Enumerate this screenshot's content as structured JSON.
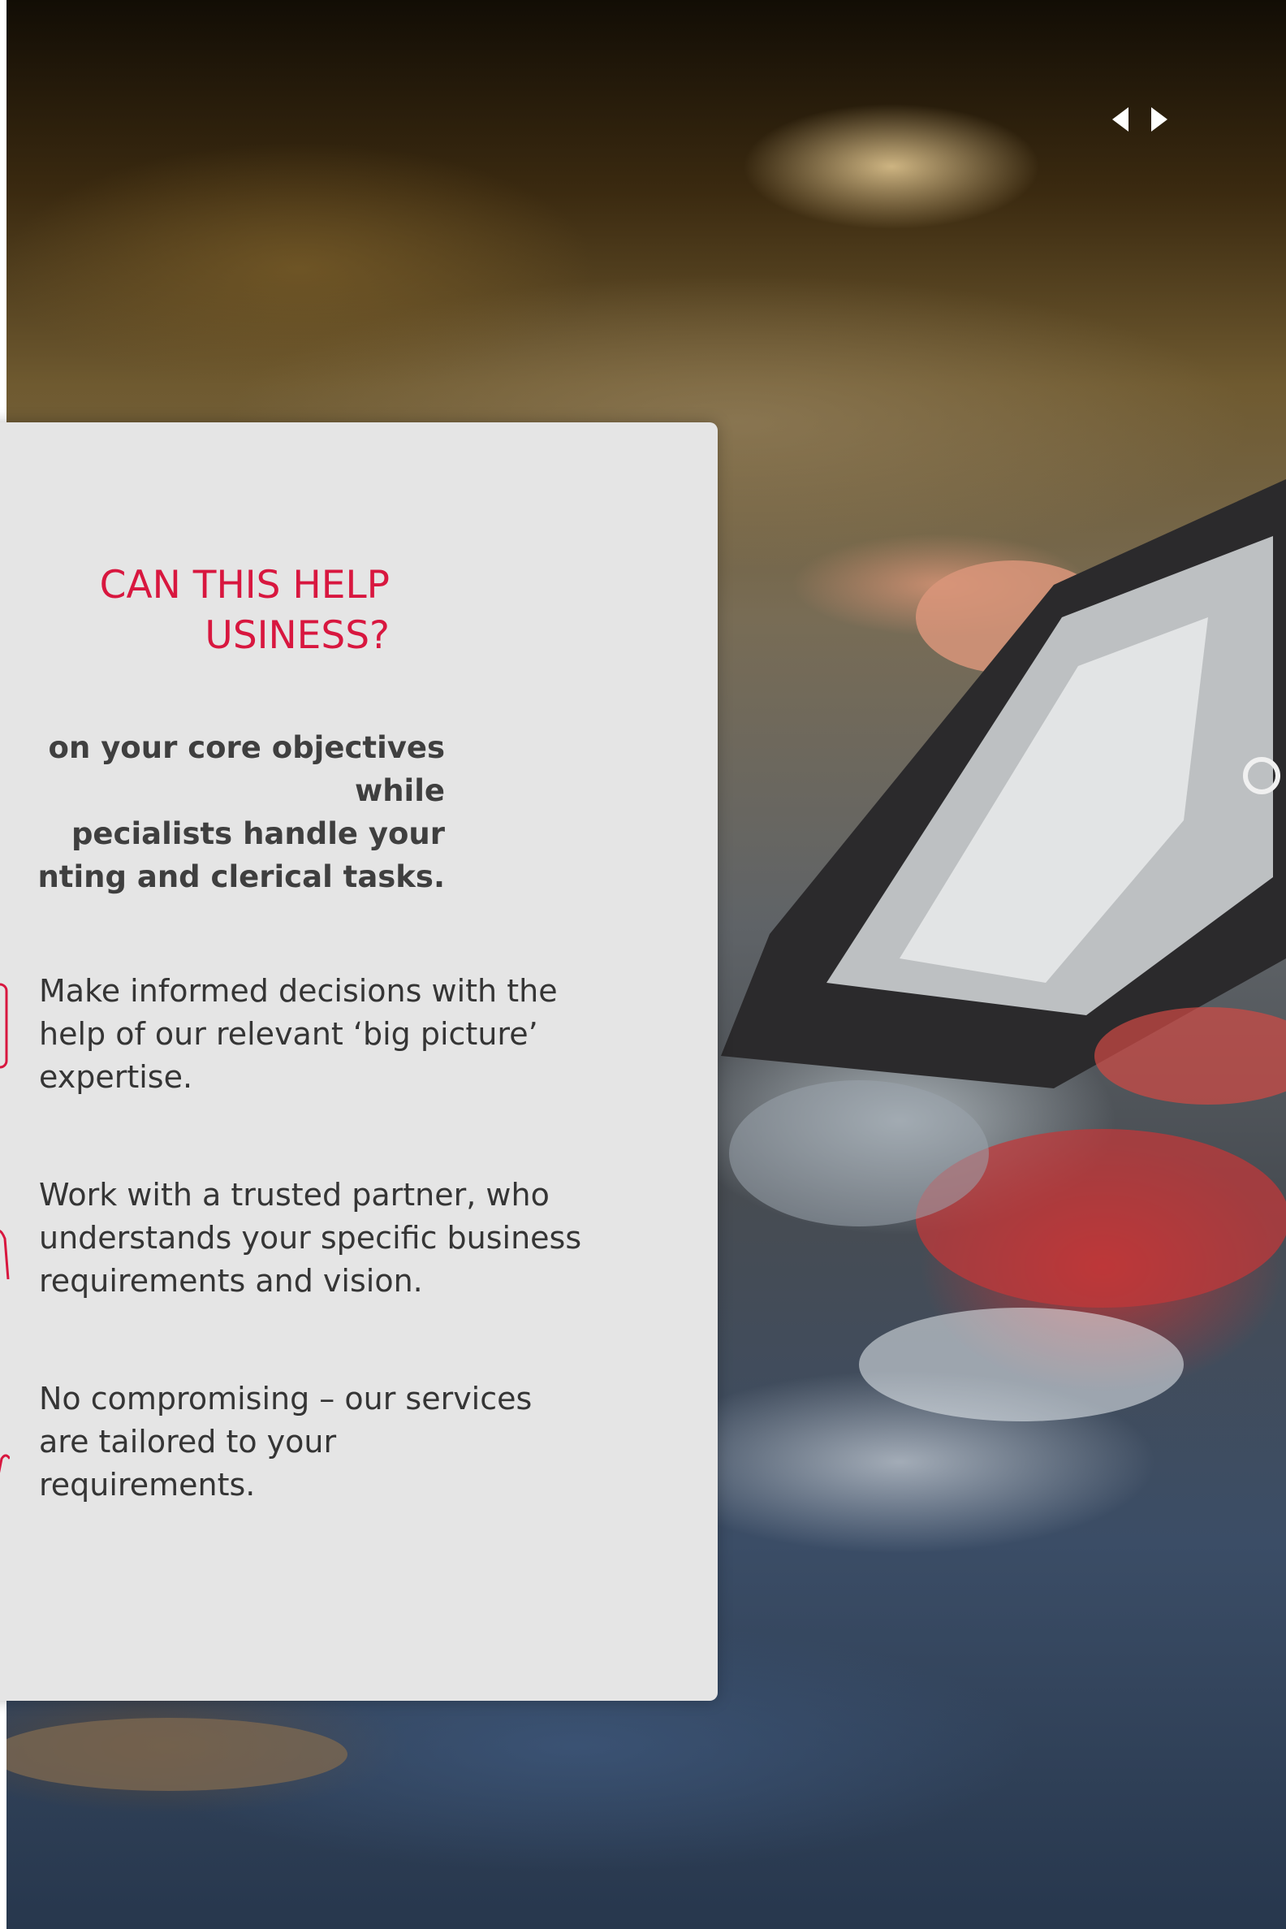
{
  "slider": {
    "prev_icon": "caret-left-icon",
    "next_icon": "caret-right-icon"
  },
  "panel": {
    "heading": "CAN THIS HELP\nUSINESS?",
    "intro": "on your core objectives while\npecialists handle your\nnting and clerical tasks.",
    "benefits": [
      {
        "icon": "document-icon",
        "text": "Make informed decisions with the\nhelp of our relevant ‘big picture’\nexpertise."
      },
      {
        "icon": "handshake-icon",
        "text": "Work with a trusted partner, who\nunderstands your specific business\nrequirements and vision."
      },
      {
        "icon": "tailored-icon",
        "text": "No compromising – our services\nare tailored to your\nrequirements."
      }
    ]
  },
  "colors": {
    "accent": "#d8173f",
    "panel_bg": "#e5e5e5",
    "text": "#353535"
  }
}
